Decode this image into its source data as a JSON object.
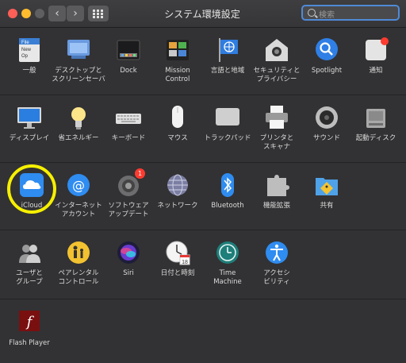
{
  "window": {
    "title": "システム環境設定"
  },
  "search": {
    "placeholder": "検索"
  },
  "nav": {
    "back": "‹",
    "forward": "›"
  },
  "rows": [
    [
      {
        "label": "一般",
        "icon": "general-icon"
      },
      {
        "label": "デスクトップと\nスクリーンセーバ",
        "icon": "desktop-screensaver-icon"
      },
      {
        "label": "Dock",
        "icon": "dock-icon"
      },
      {
        "label": "Mission\nControl",
        "icon": "mission-control-icon"
      },
      {
        "label": "言語と地域",
        "icon": "language-region-icon"
      },
      {
        "label": "セキュリティと\nプライバシー",
        "icon": "security-privacy-icon"
      },
      {
        "label": "Spotlight",
        "icon": "spotlight-icon"
      },
      {
        "label": "通知",
        "icon": "notifications-icon"
      }
    ],
    [
      {
        "label": "ディスプレイ",
        "icon": "display-icon"
      },
      {
        "label": "省エネルギー",
        "icon": "energy-saver-icon"
      },
      {
        "label": "キーボード",
        "icon": "keyboard-icon"
      },
      {
        "label": "マウス",
        "icon": "mouse-icon"
      },
      {
        "label": "トラックパッド",
        "icon": "trackpad-icon"
      },
      {
        "label": "プリンタと\nスキャナ",
        "icon": "printer-scanner-icon"
      },
      {
        "label": "サウンド",
        "icon": "sound-icon"
      },
      {
        "label": "起動ディスク",
        "icon": "startup-disk-icon"
      }
    ],
    [
      {
        "label": "iCloud",
        "icon": "icloud-icon"
      },
      {
        "label": "インターネット\nアカウント",
        "icon": "internet-accounts-icon"
      },
      {
        "label": "ソフトウェア\nアップデート",
        "icon": "software-update-icon",
        "badge": "1"
      },
      {
        "label": "ネットワーク",
        "icon": "network-icon"
      },
      {
        "label": "Bluetooth",
        "icon": "bluetooth-icon"
      },
      {
        "label": "機能拡張",
        "icon": "extensions-icon"
      },
      {
        "label": "共有",
        "icon": "sharing-icon"
      }
    ],
    [
      {
        "label": "ユーザと\nグループ",
        "icon": "users-groups-icon"
      },
      {
        "label": "ペアレンタル\nコントロール",
        "icon": "parental-controls-icon"
      },
      {
        "label": "Siri",
        "icon": "siri-icon"
      },
      {
        "label": "日付と時刻",
        "icon": "date-time-icon"
      },
      {
        "label": "Time\nMachine",
        "icon": "time-machine-icon"
      },
      {
        "label": "アクセシ\nビリティ",
        "icon": "accessibility-icon"
      }
    ],
    [
      {
        "label": "Flash Player",
        "icon": "flash-player-icon"
      }
    ]
  ],
  "icon_texts": {
    "general_file": "File",
    "general_new": "New",
    "general_open": "Op",
    "date_calendar": "18",
    "flash_letter": "f"
  },
  "colors": {
    "background": "#323234",
    "highlight": "#f6f000",
    "search_focus": "#4f8ad8",
    "badge": "#ff3b30"
  }
}
